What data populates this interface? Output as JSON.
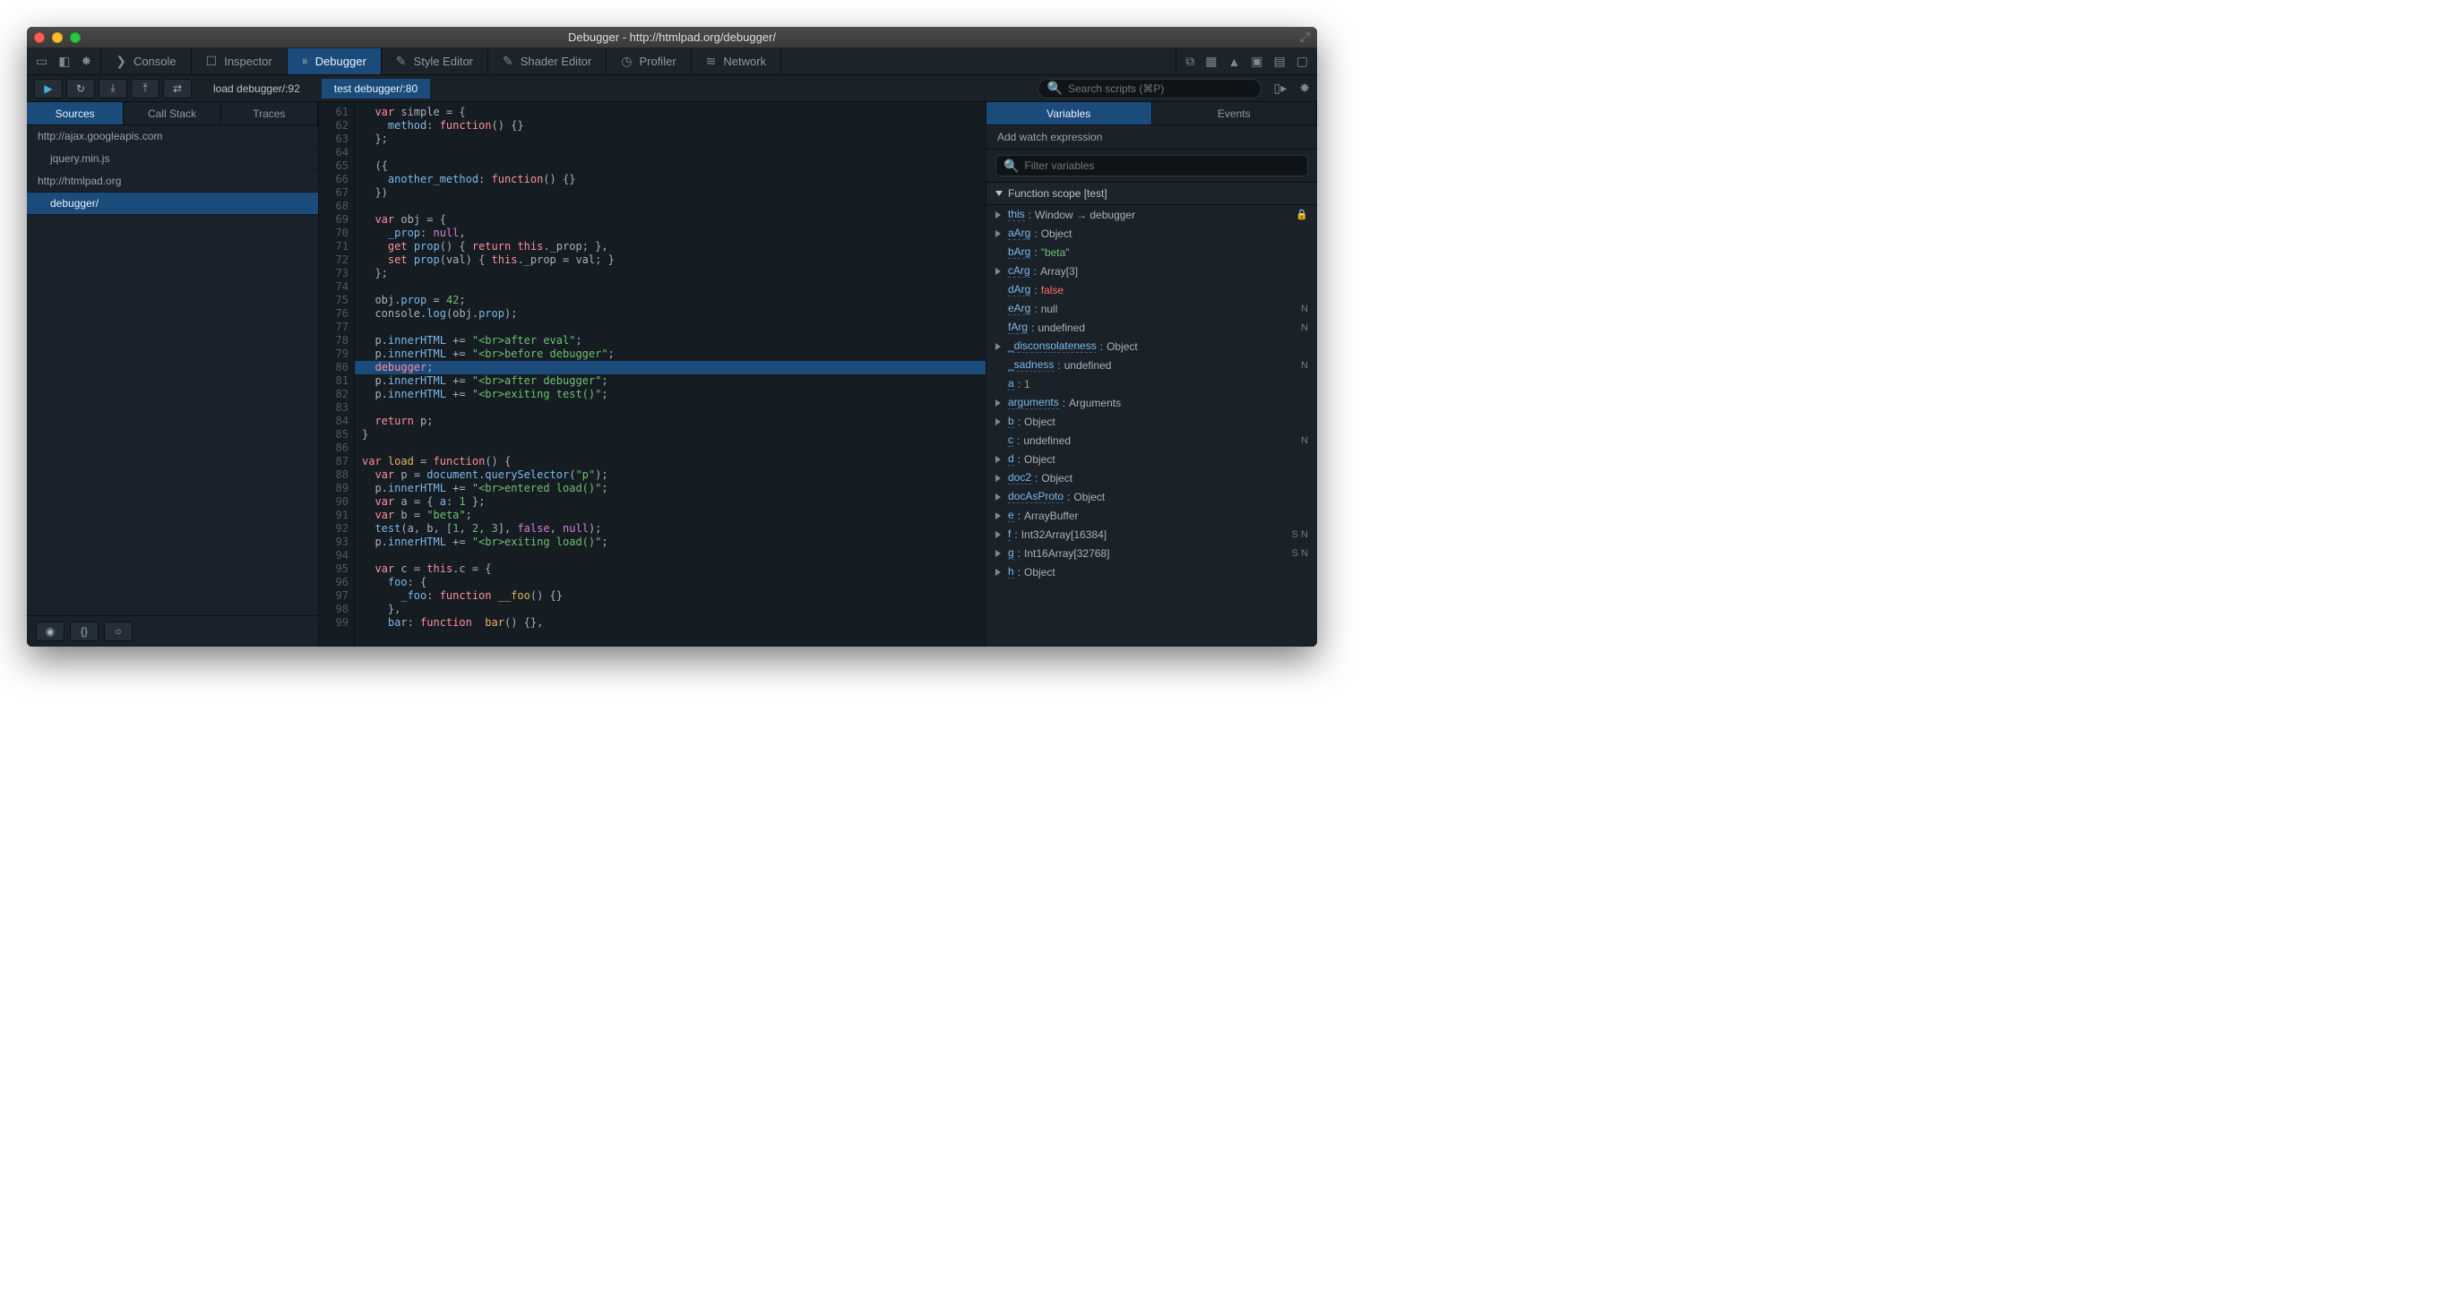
{
  "window": {
    "title": "Debugger - http://htmlpad.org/debugger/"
  },
  "toolTabs": {
    "console": "Console",
    "inspector": "Inspector",
    "debugger": "Debugger",
    "styleEditor": "Style Editor",
    "shaderEditor": "Shader Editor",
    "profiler": "Profiler",
    "network": "Network"
  },
  "stackChips": {
    "load": "load debugger/:92",
    "test": "test debugger/:80"
  },
  "search": {
    "placeholder": "Search scripts (⌘P)"
  },
  "leftTabs": {
    "sources": "Sources",
    "callStack": "Call Stack",
    "traces": "Traces"
  },
  "sources": {
    "items": [
      {
        "label": "http://ajax.googleapis.com",
        "indent": false
      },
      {
        "label": "jquery.min.js",
        "indent": true
      },
      {
        "label": "http://htmlpad.org",
        "indent": false
      },
      {
        "label": "debugger/",
        "indent": true,
        "selected": true
      }
    ]
  },
  "editor": {
    "startLine": 61,
    "highlightLine": 80,
    "breakpointLine": 80,
    "lines": [
      [
        [
          "  ",
          "op"
        ],
        [
          "var",
          "kw"
        ],
        [
          " simple = {",
          "op"
        ]
      ],
      [
        [
          "    method",
          "id"
        ],
        [
          ": ",
          "op"
        ],
        [
          "function",
          "kw"
        ],
        [
          "() {}",
          "op"
        ]
      ],
      [
        [
          "  };",
          "op"
        ]
      ],
      [
        [
          "",
          "op"
        ]
      ],
      [
        [
          "  ({",
          "op"
        ]
      ],
      [
        [
          "    another_method",
          "id"
        ],
        [
          ": ",
          "op"
        ],
        [
          "function",
          "kw"
        ],
        [
          "() {}",
          "op"
        ]
      ],
      [
        [
          "  })",
          "op"
        ]
      ],
      [
        [
          "",
          "op"
        ]
      ],
      [
        [
          "  ",
          "op"
        ],
        [
          "var",
          "kw"
        ],
        [
          " obj = {",
          "op"
        ]
      ],
      [
        [
          "    _prop",
          "id"
        ],
        [
          ": ",
          "op"
        ],
        [
          "null",
          "bool"
        ],
        [
          ",",
          "op"
        ]
      ],
      [
        [
          "    ",
          "op"
        ],
        [
          "get",
          "kw"
        ],
        [
          " ",
          "op"
        ],
        [
          "prop",
          "id"
        ],
        [
          "() { ",
          "op"
        ],
        [
          "return",
          "kw"
        ],
        [
          " ",
          "op"
        ],
        [
          "this",
          "kw"
        ],
        [
          "._prop; },",
          "op"
        ]
      ],
      [
        [
          "    ",
          "op"
        ],
        [
          "set",
          "kw"
        ],
        [
          " ",
          "op"
        ],
        [
          "prop",
          "id"
        ],
        [
          "(val) { ",
          "op"
        ],
        [
          "this",
          "kw"
        ],
        [
          "._prop = val; }",
          "op"
        ]
      ],
      [
        [
          "  };",
          "op"
        ]
      ],
      [
        [
          "",
          "op"
        ]
      ],
      [
        [
          "  obj.",
          "op"
        ],
        [
          "prop",
          "id"
        ],
        [
          " = ",
          "op"
        ],
        [
          "42",
          "num"
        ],
        [
          ";",
          "op"
        ]
      ],
      [
        [
          "  console.",
          "op"
        ],
        [
          "log",
          "id"
        ],
        [
          "(obj.",
          "op"
        ],
        [
          "prop",
          "id"
        ],
        [
          ");",
          "op"
        ]
      ],
      [
        [
          "",
          "op"
        ]
      ],
      [
        [
          "  p.",
          "op"
        ],
        [
          "innerHTML",
          "id"
        ],
        [
          " += ",
          "op"
        ],
        [
          "\"<br>after eval\"",
          "str"
        ],
        [
          ";",
          "op"
        ]
      ],
      [
        [
          "  p.",
          "op"
        ],
        [
          "innerHTML",
          "id"
        ],
        [
          " += ",
          "op"
        ],
        [
          "\"<br>before debugger\"",
          "str"
        ],
        [
          ";",
          "op"
        ]
      ],
      [
        [
          "  ",
          "op"
        ],
        [
          "debugger",
          "kw"
        ],
        [
          ";",
          "op"
        ]
      ],
      [
        [
          "  p.",
          "op"
        ],
        [
          "innerHTML",
          "id"
        ],
        [
          " += ",
          "op"
        ],
        [
          "\"<br>after debugger\"",
          "str"
        ],
        [
          ";",
          "op"
        ]
      ],
      [
        [
          "  p.",
          "op"
        ],
        [
          "innerHTML",
          "id"
        ],
        [
          " += ",
          "op"
        ],
        [
          "\"<br>exiting test()\"",
          "str"
        ],
        [
          ";",
          "op"
        ]
      ],
      [
        [
          "",
          "op"
        ]
      ],
      [
        [
          "  ",
          "op"
        ],
        [
          "return",
          "kw"
        ],
        [
          " p;",
          "op"
        ]
      ],
      [
        [
          "}",
          "op"
        ]
      ],
      [
        [
          "",
          "op"
        ]
      ],
      [
        [
          "var",
          "kw"
        ],
        [
          " ",
          "op"
        ],
        [
          "load",
          "def"
        ],
        [
          " = ",
          "op"
        ],
        [
          "function",
          "kw"
        ],
        [
          "() {",
          "op"
        ]
      ],
      [
        [
          "  ",
          "op"
        ],
        [
          "var",
          "kw"
        ],
        [
          " p = ",
          "op"
        ],
        [
          "document",
          "id"
        ],
        [
          ".",
          "op"
        ],
        [
          "querySelector",
          "id"
        ],
        [
          "(",
          "op"
        ],
        [
          "\"p\"",
          "str"
        ],
        [
          ");",
          "op"
        ]
      ],
      [
        [
          "  p.",
          "op"
        ],
        [
          "innerHTML",
          "id"
        ],
        [
          " += ",
          "op"
        ],
        [
          "\"<br>entered load()\"",
          "str"
        ],
        [
          ";",
          "op"
        ]
      ],
      [
        [
          "  ",
          "op"
        ],
        [
          "var",
          "kw"
        ],
        [
          " a = { ",
          "op"
        ],
        [
          "a",
          "id"
        ],
        [
          ": ",
          "op"
        ],
        [
          "1",
          "num"
        ],
        [
          " };",
          "op"
        ]
      ],
      [
        [
          "  ",
          "op"
        ],
        [
          "var",
          "kw"
        ],
        [
          " b = ",
          "op"
        ],
        [
          "\"beta\"",
          "str"
        ],
        [
          ";",
          "op"
        ]
      ],
      [
        [
          "  ",
          "op"
        ],
        [
          "test",
          "id"
        ],
        [
          "(a, b, [",
          "op"
        ],
        [
          "1",
          "num"
        ],
        [
          ", ",
          "op"
        ],
        [
          "2",
          "num"
        ],
        [
          ", ",
          "op"
        ],
        [
          "3",
          "num"
        ],
        [
          "], ",
          "op"
        ],
        [
          "false",
          "bool"
        ],
        [
          ", ",
          "op"
        ],
        [
          "null",
          "bool"
        ],
        [
          ");",
          "op"
        ]
      ],
      [
        [
          "  p.",
          "op"
        ],
        [
          "innerHTML",
          "id"
        ],
        [
          " += ",
          "op"
        ],
        [
          "\"<br>exiting load()\"",
          "str"
        ],
        [
          ";",
          "op"
        ]
      ],
      [
        [
          "",
          "op"
        ]
      ],
      [
        [
          "  ",
          "op"
        ],
        [
          "var",
          "kw"
        ],
        [
          " c = ",
          "op"
        ],
        [
          "this",
          "kw"
        ],
        [
          ".c = {",
          "op"
        ]
      ],
      [
        [
          "    foo",
          "id"
        ],
        [
          ": {",
          "op"
        ]
      ],
      [
        [
          "      _foo",
          "id"
        ],
        [
          ": ",
          "op"
        ],
        [
          "function",
          "kw"
        ],
        [
          " ",
          "op"
        ],
        [
          "__foo",
          "def"
        ],
        [
          "() {}",
          "op"
        ]
      ],
      [
        [
          "    },",
          "op"
        ]
      ],
      [
        [
          "    bar",
          "id"
        ],
        [
          ": ",
          "op"
        ],
        [
          "function",
          "kw"
        ],
        [
          "  ",
          "op"
        ],
        [
          "bar",
          "def"
        ],
        [
          "() {},",
          "op"
        ]
      ]
    ]
  },
  "rightTabs": {
    "variables": "Variables",
    "events": "Events"
  },
  "watch": {
    "label": "Add watch expression",
    "placeholder": "Filter variables"
  },
  "scope": {
    "label": "Function scope [test]"
  },
  "vars": [
    {
      "arrow": true,
      "name": "this",
      "sep": ": ",
      "val": "Window → debugger",
      "cls": "",
      "tag": "🔒"
    },
    {
      "arrow": true,
      "name": "aArg",
      "sep": ": ",
      "val": "Object",
      "cls": ""
    },
    {
      "arrow": false,
      "name": "bArg",
      "sep": ": ",
      "val": "\"beta\"",
      "cls": "str"
    },
    {
      "arrow": true,
      "name": "cArg",
      "sep": ": ",
      "val": "Array[3]",
      "cls": ""
    },
    {
      "arrow": false,
      "name": "dArg",
      "sep": ": ",
      "val": "false",
      "cls": "bool"
    },
    {
      "arrow": false,
      "name": "eArg",
      "sep": ": ",
      "val": "null",
      "cls": "",
      "tag": "N"
    },
    {
      "arrow": false,
      "name": "fArg",
      "sep": ": ",
      "val": "undefined",
      "cls": "",
      "tag": "N"
    },
    {
      "arrow": true,
      "name": "_disconsolateness",
      "sep": ": ",
      "val": "Object",
      "cls": ""
    },
    {
      "arrow": false,
      "name": "_sadness",
      "sep": ": ",
      "val": "undefined",
      "cls": "",
      "tag": "N"
    },
    {
      "arrow": false,
      "name": "a",
      "sep": ": ",
      "val": "1",
      "cls": "num"
    },
    {
      "arrow": true,
      "name": "arguments",
      "sep": ": ",
      "val": "Arguments",
      "cls": ""
    },
    {
      "arrow": true,
      "name": "b",
      "sep": ": ",
      "val": "Object",
      "cls": ""
    },
    {
      "arrow": false,
      "name": "c",
      "sep": ": ",
      "val": "undefined",
      "cls": "",
      "tag": "N"
    },
    {
      "arrow": true,
      "name": "d",
      "sep": ": ",
      "val": "Object",
      "cls": ""
    },
    {
      "arrow": true,
      "name": "doc2",
      "sep": ": ",
      "val": "Object",
      "cls": ""
    },
    {
      "arrow": true,
      "name": "docAsProto",
      "sep": ": ",
      "val": "Object",
      "cls": ""
    },
    {
      "arrow": true,
      "name": "e",
      "sep": ": ",
      "val": "ArrayBuffer",
      "cls": ""
    },
    {
      "arrow": true,
      "name": "f",
      "sep": ": ",
      "val": "Int32Array[16384]",
      "cls": "",
      "tag": "S N"
    },
    {
      "arrow": true,
      "name": "g",
      "sep": ": ",
      "val": "Int16Array[32768]",
      "cls": "",
      "tag": "S N"
    },
    {
      "arrow": true,
      "name": "h",
      "sep": ": ",
      "val": "Object",
      "cls": ""
    }
  ]
}
